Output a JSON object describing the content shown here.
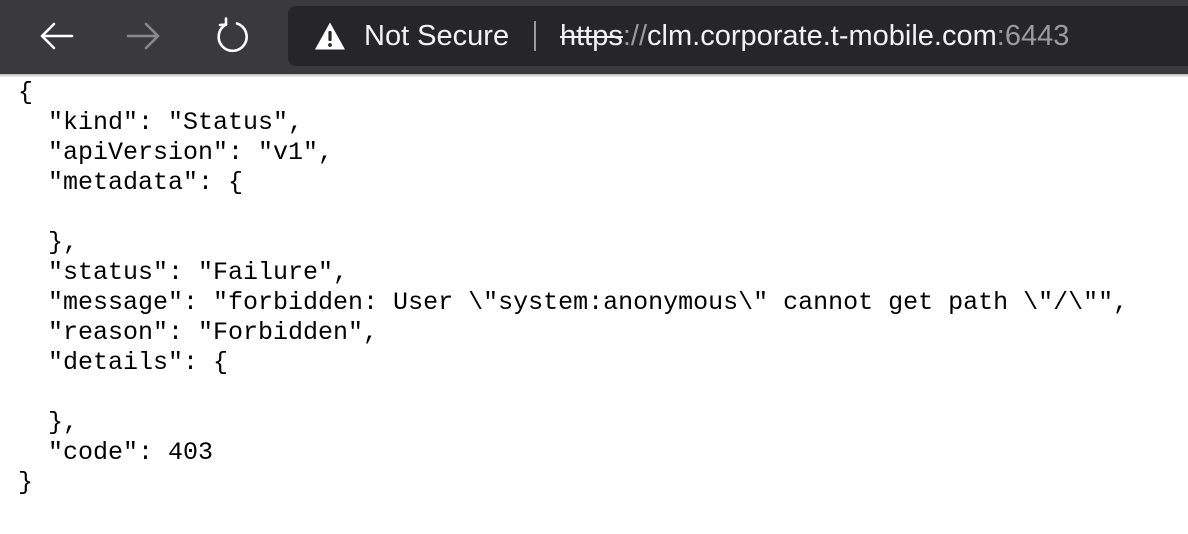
{
  "browser": {
    "nav": {
      "back_icon": "arrow-left-icon",
      "forward_icon": "arrow-right-icon",
      "reload_icon": "reload-icon"
    },
    "address_bar": {
      "warning_icon": "warning-triangle-icon",
      "security_label": "Not Secure",
      "url_scheme": "https",
      "url_separator": "://",
      "url_host": "clm.corporate.t-mobile.com",
      "url_port": ":6443"
    },
    "colors": {
      "toolbar": "#3a3a3c",
      "address_bar": "#262628"
    }
  },
  "page": {
    "json_text": "{\n  \"kind\": \"Status\",\n  \"apiVersion\": \"v1\",\n  \"metadata\": {\n\n  },\n  \"status\": \"Failure\",\n  \"message\": \"forbidden: User \\\"system:anonymous\\\" cannot get path \\\"/\\\"\",\n  \"reason\": \"Forbidden\",\n  \"details\": {\n\n  },\n  \"code\": 403\n}"
  }
}
